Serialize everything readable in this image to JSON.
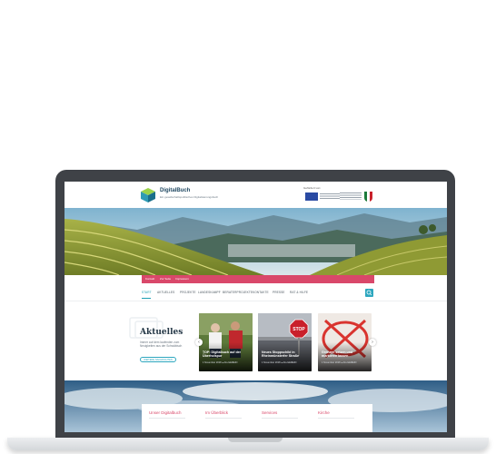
{
  "site": {
    "title": "DigitalBuch",
    "subtitle": "Ein gesellschaftspolitisches Digitalisierungsbuch",
    "funding_label": "Gefördert von:"
  },
  "sub_bar": {
    "links": [
      "Kontakt",
      "Zur Seite",
      "Impressum"
    ]
  },
  "nav": {
    "items": [
      {
        "label": "START",
        "active": true
      },
      {
        "label": "AKTUELLES",
        "active": false
      },
      {
        "label": "PROJEKTE",
        "active": false
      },
      {
        "label": "LANDESKAMPF",
        "active": false
      },
      {
        "label": "BERATERPROJEKTE",
        "active": false
      },
      {
        "label": "KONTAKTE",
        "active": false
      },
      {
        "label": "PRESSE",
        "active": false
      },
      {
        "label": "RAT & HILFE",
        "active": false
      }
    ]
  },
  "news": {
    "heading": "Aktuelles",
    "description": "Immer auf dem laufenden zum Neuigkeiten aus der Schwäbisch",
    "button_label": "WEITERE NACHRICHTEN",
    "cards": [
      {
        "title": "TOP: Digitalbuch auf der Überholspur",
        "date": "1 November 2018 ● ALLGEMEIN"
      },
      {
        "title": "Neues Stoppschild in Rheinmünsterfer Straße",
        "date": "1 November 2018 ● ALLGEMEIN"
      },
      {
        "title": "Grenzen setzen und markieren lassen",
        "date": "1 November 2018 ● ALLGEMEIN"
      }
    ],
    "prev_label": "‹",
    "next_label": "›"
  },
  "info": {
    "columns": [
      "Unser Digitalbuch",
      "Im Überblick",
      "Services",
      "Kirche"
    ]
  },
  "colors": {
    "accent": "#d9486a",
    "teal": "#2da7bf",
    "lid": "#3f4247"
  }
}
